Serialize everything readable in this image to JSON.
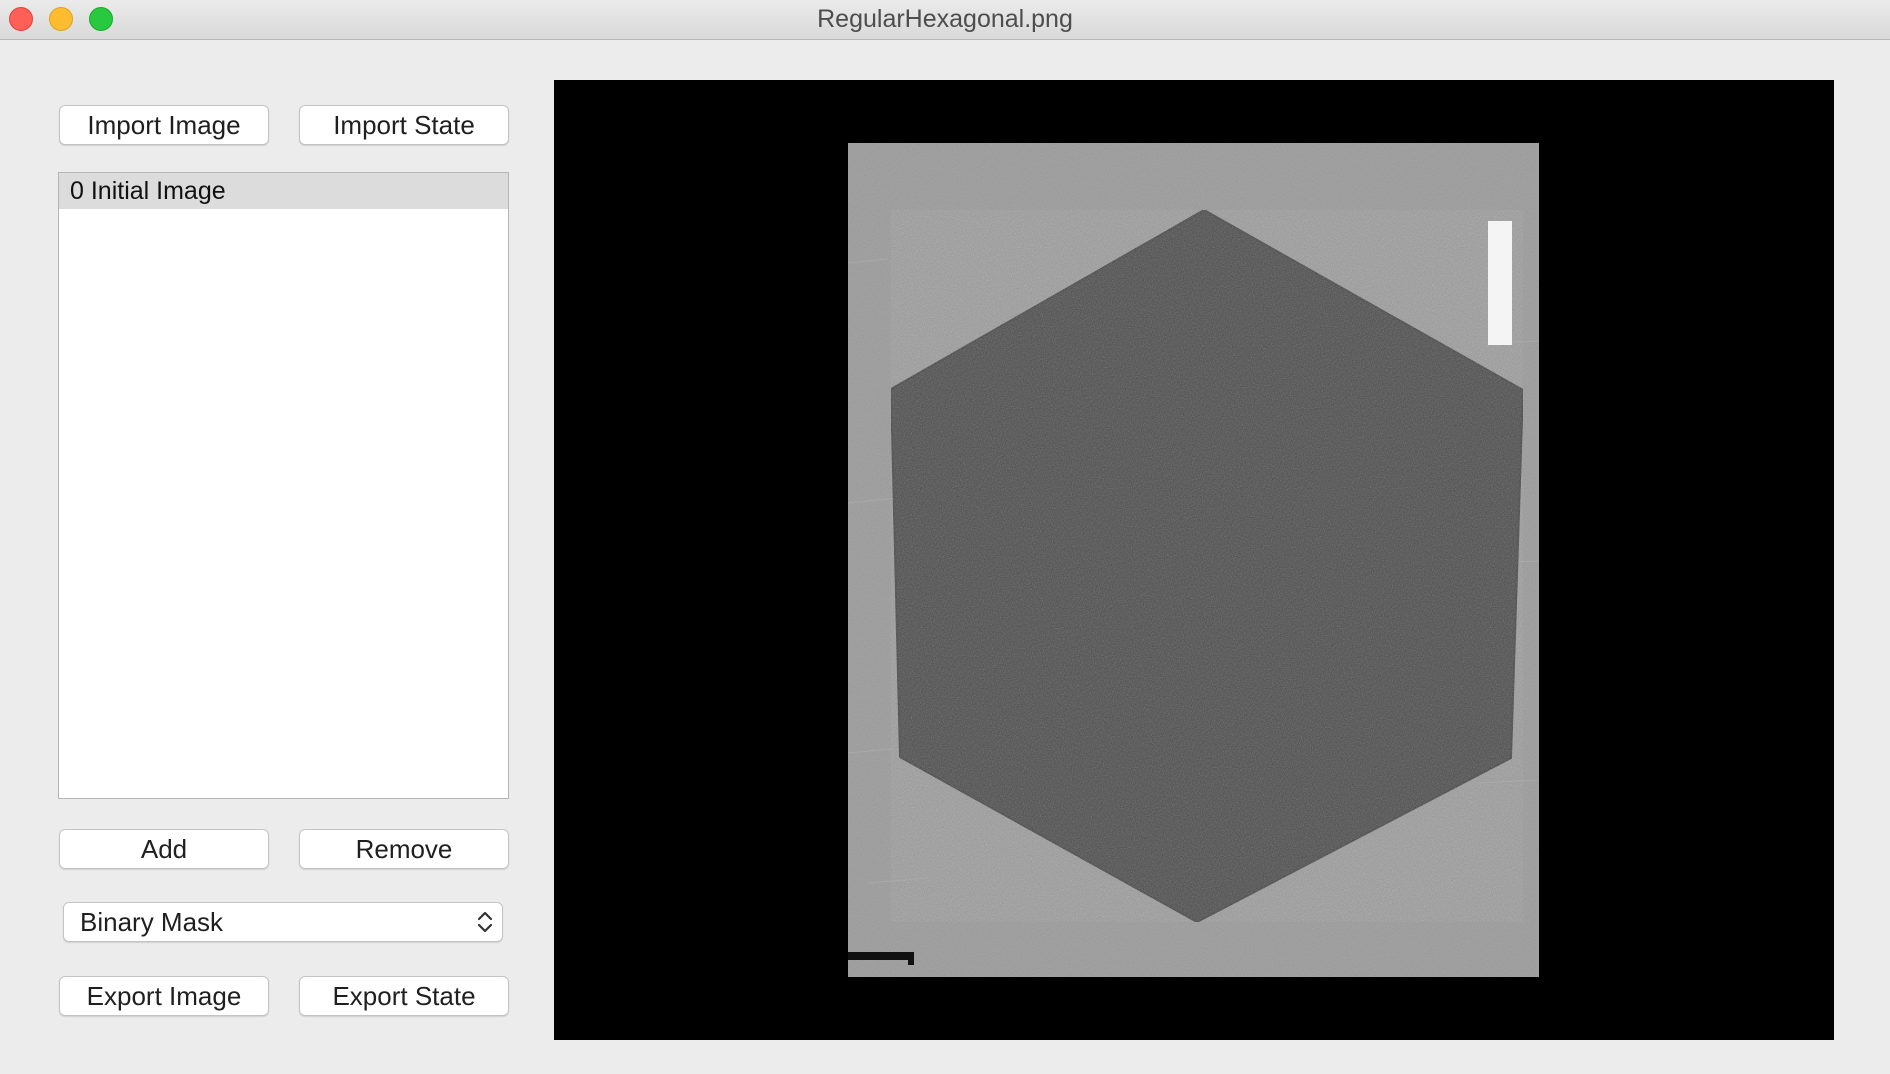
{
  "window": {
    "title": "RegularHexagonal.png"
  },
  "toolbar": {
    "import_image_label": "Import Image",
    "import_state_label": "Import State",
    "add_label": "Add",
    "remove_label": "Remove",
    "export_image_label": "Export Image",
    "export_state_label": "Export State"
  },
  "steps": {
    "items": [
      {
        "label": "0 Initial Image",
        "selected": true
      }
    ]
  },
  "operation_select": {
    "value": "Binary Mask"
  },
  "viewer": {
    "background": "#000000",
    "image_background": "#9a9a9a",
    "hexagon_fill": "#4a4a4a"
  },
  "icons": {
    "window_close": "close-traffic-light-icon",
    "window_minimize": "minimize-traffic-light-icon",
    "window_zoom": "zoom-traffic-light-icon",
    "select_arrows": "up-down-chevron-icon"
  }
}
